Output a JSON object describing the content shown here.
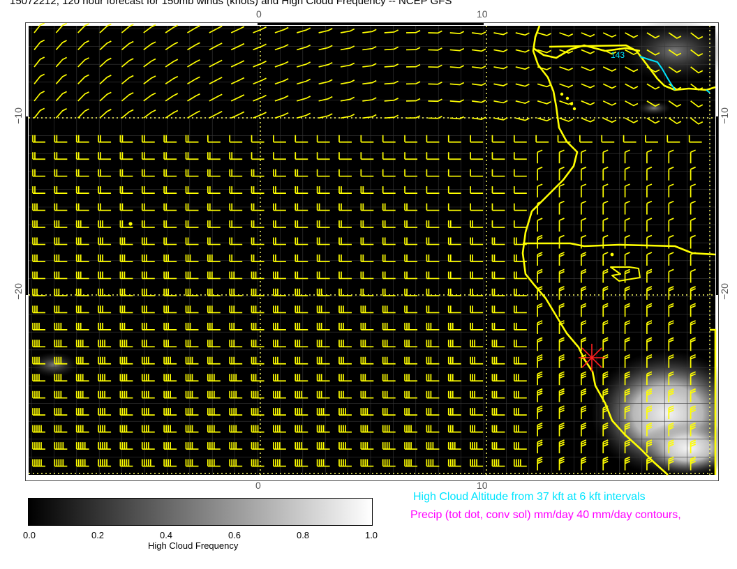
{
  "title": "15072212, 120 hour forecast for 150mb winds (knots) and High Cloud Frequency -- NCEP GFS",
  "axes": {
    "x_ticks_top": [
      "0",
      "10"
    ],
    "x_ticks_bottom": [
      "0",
      "10"
    ],
    "y_ticks_left": [
      "−10",
      "−20"
    ],
    "y_ticks_right": [
      "−10",
      "−20"
    ]
  },
  "map": {
    "wind_barb_color": "#ffff00",
    "coastline_color": "#ffff00",
    "background_color": "#000000",
    "grid_color": "#ffff66",
    "cloud_contour_label": "143",
    "cloud_contour_color": "#00e5ff",
    "marker": "red-star",
    "marker_color": "#ff2020"
  },
  "colorbar": {
    "labels": [
      "0.0",
      "0.2",
      "0.4",
      "0.6",
      "0.8",
      "1.0"
    ],
    "title": "High Cloud Frequency",
    "gradient": [
      "#000000",
      "#ffffff"
    ]
  },
  "notes": {
    "cloud_altitude": "High Cloud Altitude from 37 kft at 6 kft intervals",
    "precip": "Precip (tot dot, conv sol) mm/day 40 mm/day contours,"
  }
}
